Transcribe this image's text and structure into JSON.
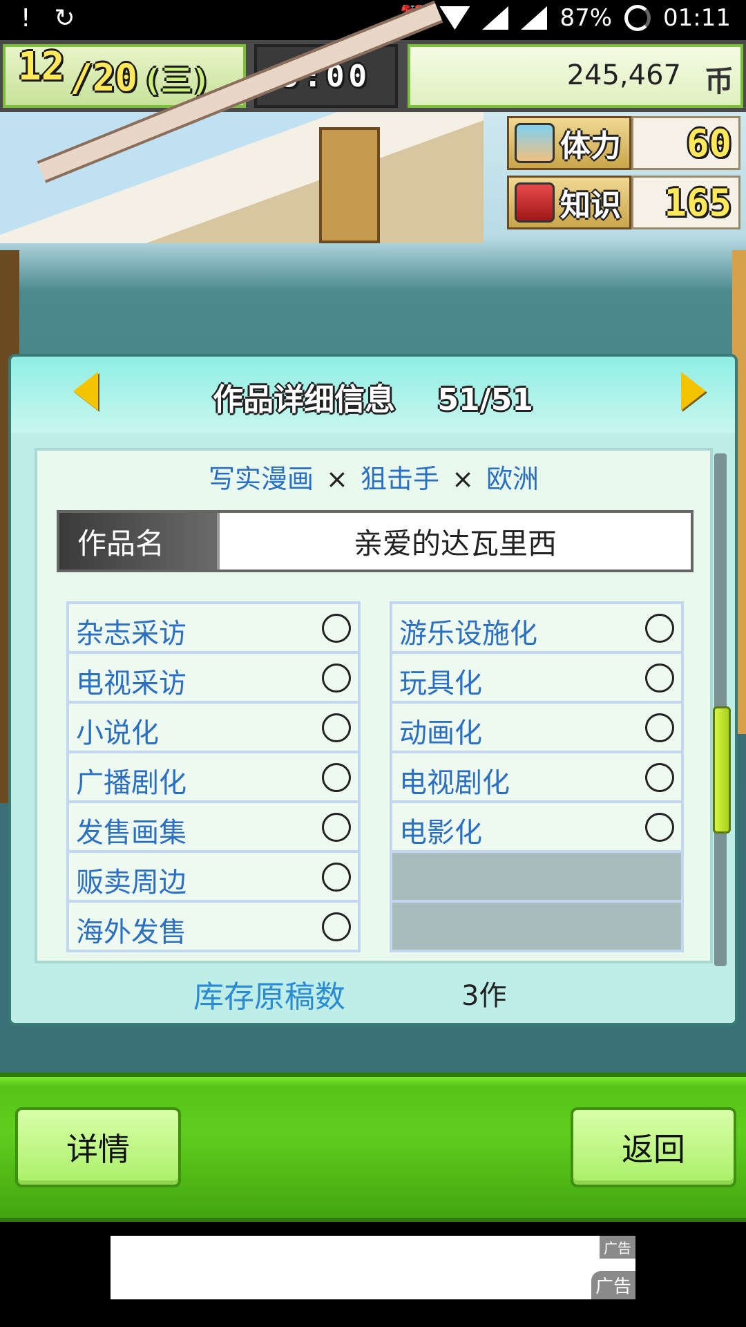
{
  "status_bar": {
    "left_icons": [
      "!",
      "sync-icon"
    ],
    "battery": "87%",
    "time": "01:11"
  },
  "hud": {
    "month": "12",
    "day": "/20",
    "weekday": "(三)",
    "time_display": "9:00",
    "money": "245,467",
    "currency": "币"
  },
  "stats": [
    {
      "name": "体力",
      "value": "60",
      "icon": "muscle-arm-icon"
    },
    {
      "name": "知识",
      "value": "165",
      "icon": "red-book-icon"
    }
  ],
  "dialog": {
    "title": "作品详细信息    51/51",
    "genres": [
      "写实漫画",
      "狙击手",
      "欧洲"
    ],
    "genre_separator": "×",
    "name_label": "作品名",
    "name_value": "亲爱的达瓦里西",
    "left_list": [
      "杂志采访",
      "电视采访",
      "小说化",
      "广播剧化",
      "发售画集",
      "贩卖周边",
      "海外发售"
    ],
    "right_list": [
      "游乐设施化",
      "玩具化",
      "动画化",
      "电视剧化",
      "电影化"
    ],
    "stock_label": "库存原稿数",
    "stock_value": "3作"
  },
  "buttons": {
    "detail": "详情",
    "back": "返回"
  },
  "ad": {
    "tag_small": "广告",
    "tag_large": "广告"
  },
  "colors": {
    "accent_green": "#56c416",
    "link_blue": "#2a6fc4",
    "dialog_bg": "#bfeee8"
  }
}
